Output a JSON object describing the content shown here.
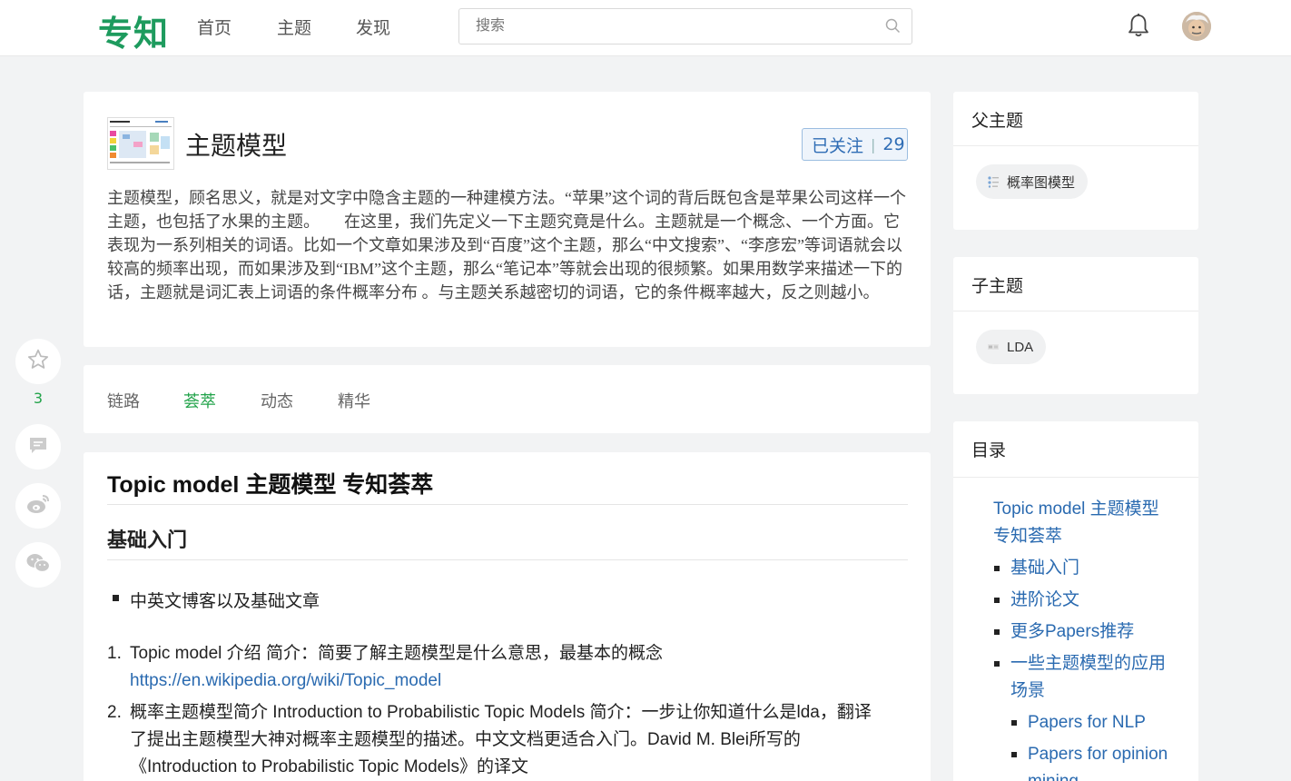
{
  "header": {
    "logo": "专知",
    "nav": [
      "首页",
      "主题",
      "发现"
    ],
    "search_placeholder": "搜索"
  },
  "left_actions": {
    "star_count": "3"
  },
  "topic": {
    "title": "主题模型",
    "follow_label": "已关注",
    "follow_count": "29",
    "description": "主题模型，顾名思义，就是对文字中隐含主题的一种建模方法。“苹果”这个词的背后既包含是苹果公司这样一个主题，也包括了水果的主题。　　在这里，我们先定义一下主题究竟是什么。主题就是一个概念、一个方面。它表现为一系列相关的词语。比如一个文章如果涉及到“百度”这个主题，那么“中文搜索”、“李彦宏”等词语就会以较高的频率出现，而如果涉及到“IBM”这个主题，那么“笔记本”等就会出现的很频繁。如果用数学来描述一下的话，主题就是词汇表上词语的条件概率分布 。与主题关系越密切的词语，它的条件概率越大，反之则越小。"
  },
  "tabs": [
    {
      "label": "链路",
      "active": false
    },
    {
      "label": "荟萃",
      "active": true
    },
    {
      "label": "动态",
      "active": false
    },
    {
      "label": "精华",
      "active": false
    }
  ],
  "content": {
    "h1": "Topic model 主题模型 专知荟萃",
    "h2": "基础入门",
    "bullet": "中英文博客以及基础文章",
    "items": [
      {
        "num": "1.",
        "text": "Topic model 介绍 简介：简要了解主题模型是什么意思，最基本的概念",
        "link": "https://en.wikipedia.org/wiki/Topic_model"
      },
      {
        "num": "2.",
        "text": "概率主题模型简介 Introduction to Probabilistic Topic Models 简介：一步让你知道什么是lda，翻译了提出主题模型大神对概率主题模型的描述。中文文档更适合入门。David M. Blei所写的《Introduction to Probabilistic Topic Models》的译文"
      }
    ]
  },
  "sidebar": {
    "parent": {
      "title": "父主题",
      "pill": "概率图模型"
    },
    "child": {
      "title": "子主题",
      "pill": "LDA"
    },
    "toc": {
      "title": "目录",
      "root": "Topic model 主题模型 专知荟萃",
      "items": [
        "基础入门",
        "进阶论文",
        "更多Papers推荐",
        "一些主题模型的应用场景"
      ],
      "sub_items": [
        "Papers for NLP",
        "Papers for opinion mining"
      ]
    }
  },
  "colors": {
    "brand_green": "#1e9b5e",
    "active_tab": "#22a34a",
    "link_blue": "#2a6ab0"
  }
}
